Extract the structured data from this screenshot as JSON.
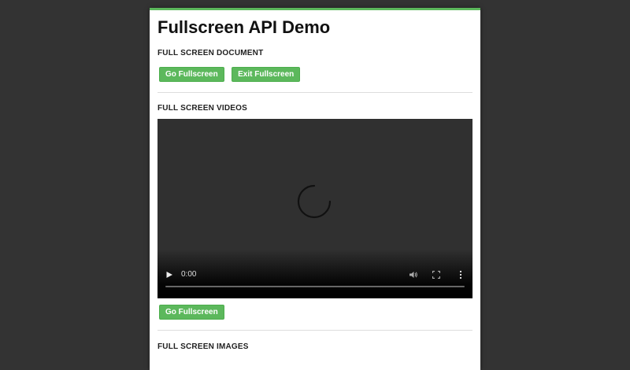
{
  "title": "Fullscreen API Demo",
  "sections": {
    "document": {
      "title": "FULL SCREEN DOCUMENT",
      "go_label": "Go Fullscreen",
      "exit_label": "Exit Fullscreen"
    },
    "videos": {
      "title": "FULL SCREEN VIDEOS",
      "current_time": "0:00",
      "go_label": "Go Fullscreen"
    },
    "images": {
      "title": "FULL SCREEN IMAGES"
    }
  },
  "colors": {
    "accent": "#5cb85c",
    "background": "#333333"
  },
  "icons": {
    "play": "play-icon",
    "volume": "volume-icon",
    "fullscreen": "fullscreen-icon",
    "more": "more-options-icon",
    "loading": "loading-spinner-icon"
  }
}
